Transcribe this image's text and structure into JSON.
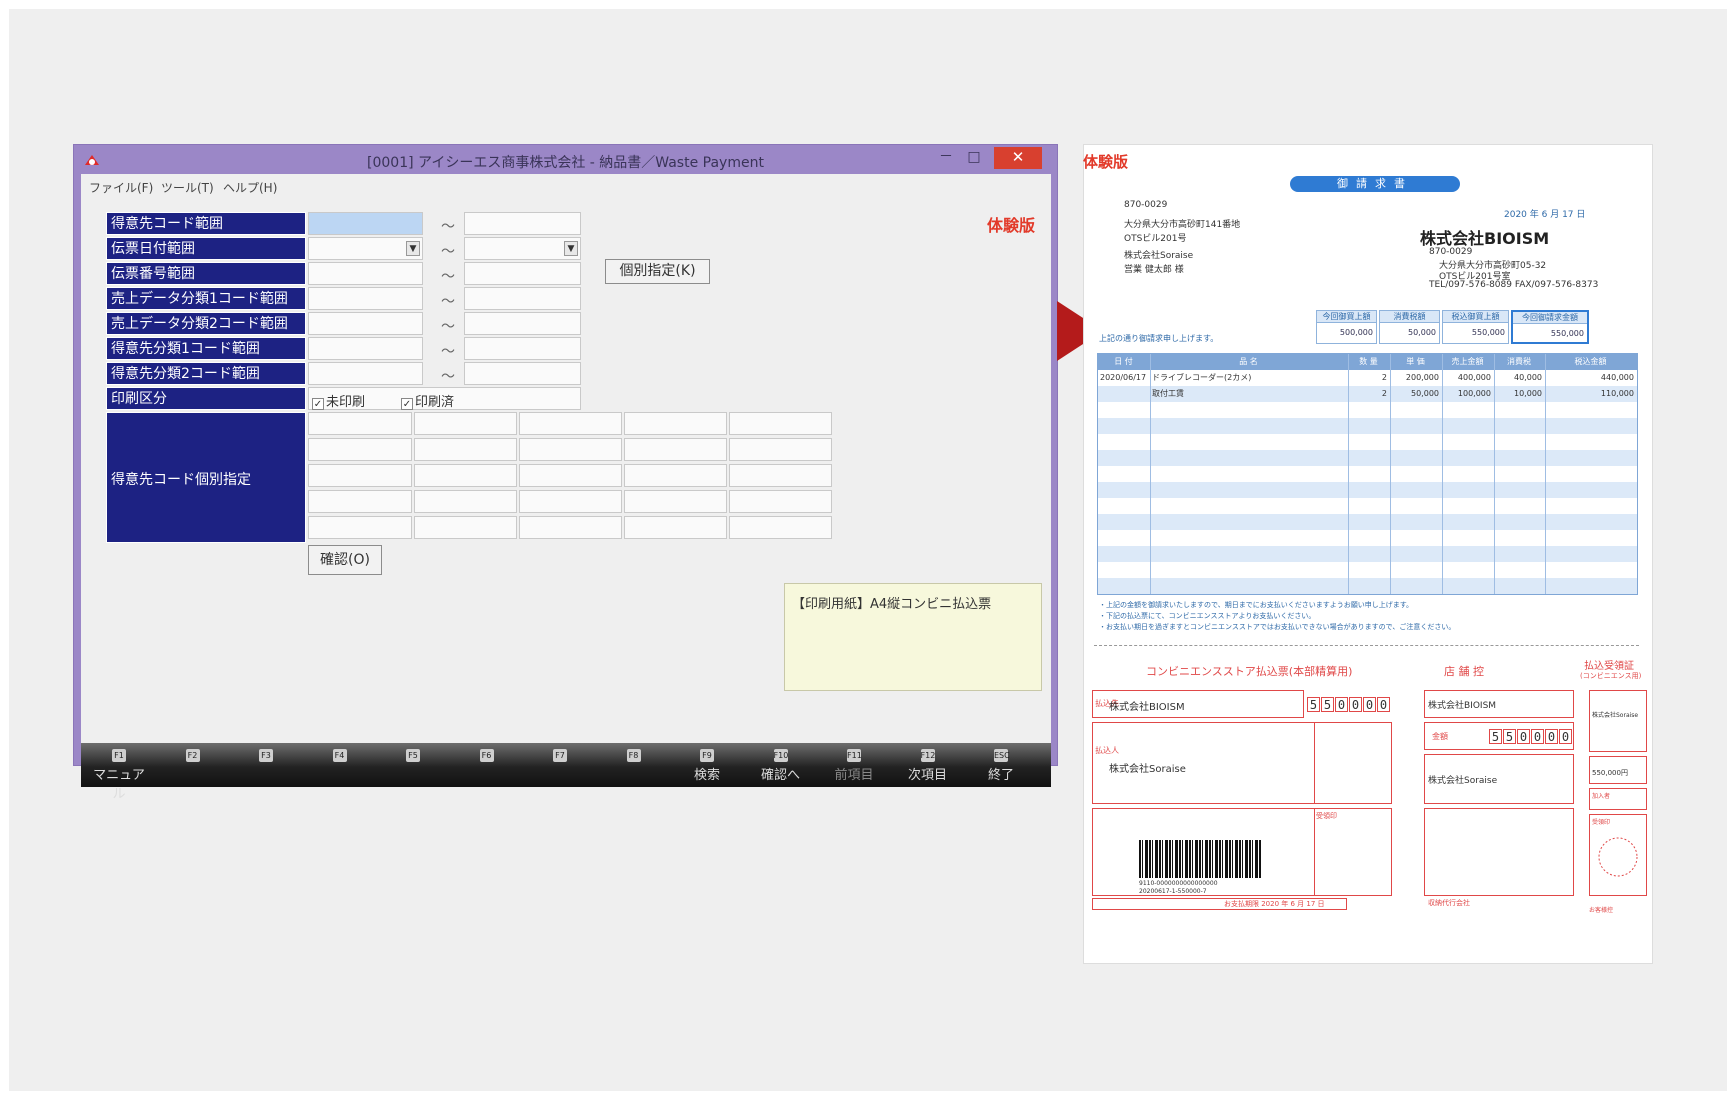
{
  "window": {
    "title": "[0001] アイシーエス商事株式会社 - 納品書／Waste Payment",
    "minimize": "－",
    "maximize": "□",
    "close": "✕"
  },
  "menu": {
    "file": "ファイル(F)",
    "tools": "ツール(T)",
    "help": "ヘルプ(H)"
  },
  "trial_label": "体験版",
  "form": {
    "labels": [
      "得意先コード範囲",
      "伝票日付範囲",
      "伝票番号範囲",
      "売上データ分類1コード範囲",
      "売上データ分類2コード範囲",
      "得意先分類1コード範囲",
      "得意先分類2コード範囲",
      "印刷区分"
    ],
    "tilde": "～",
    "individual_button": "個別指定(K)",
    "print_unprinted": "未印刷",
    "print_printed": "印刷済",
    "grid_label": "得意先コード個別指定",
    "confirm_button": "確認(O)",
    "paper_note": "【印刷用紙】A4縦コンビニ払込票"
  },
  "fkeys": [
    {
      "key": "F1",
      "label": "マニュアル"
    },
    {
      "key": "F2",
      "label": ""
    },
    {
      "key": "F3",
      "label": ""
    },
    {
      "key": "F4",
      "label": ""
    },
    {
      "key": "F5",
      "label": ""
    },
    {
      "key": "F6",
      "label": ""
    },
    {
      "key": "F7",
      "label": ""
    },
    {
      "key": "F8",
      "label": ""
    },
    {
      "key": "F9",
      "label": "検索"
    },
    {
      "key": "F10",
      "label": "確認へ"
    },
    {
      "key": "F11",
      "label": "前項目"
    },
    {
      "key": "F12",
      "label": "次項目"
    },
    {
      "key": "ESC",
      "label": "終了"
    }
  ],
  "invoice": {
    "trial_label": "体験版",
    "heading": "御請求書",
    "to_zip": "870-0029",
    "to_addr1": "大分県大分市高砂町141番地",
    "to_addr2": "OTSビル201号",
    "to_company": "株式会社Soraise",
    "to_person": "営業 健太郎 様",
    "date": "2020 年 6 月 17 日",
    "company": "株式会社BIOISM",
    "co_zip": "870-0029",
    "co_addr1": "大分県大分市高砂町05-32",
    "co_addr2": "OTSビル201号室",
    "co_tel": "TEL/097-576-8089 FAX/097-576-8373",
    "summary_headers": [
      "今回御買上額",
      "消費税額",
      "税込御買上額",
      "今回御請求金額"
    ],
    "summary_values": [
      "500,000",
      "50,000",
      "550,000",
      "550,000"
    ],
    "intro": "上記の通り御請求申し上げます。",
    "columns": [
      "日 付",
      "品 名",
      "数 量",
      "単 価",
      "売上金額",
      "消費税",
      "税込金額"
    ],
    "rows": [
      [
        "2020/06/17",
        "ドライブレコーダー(2カメ)",
        "2",
        "200,000",
        "400,000",
        "40,000",
        "440,000"
      ],
      [
        "",
        "取付工賃",
        "2",
        "50,000",
        "100,000",
        "10,000",
        "110,000"
      ]
    ],
    "notes": [
      "・上記の金額を御請求いたしますので、期日までにお支払いくださいますようお願い申し上げます。",
      "・下記の払込票にて、コンビニエンスストアよりお支払いください。",
      "・お支払い期日を過ぎますとコンビニエンスストアではお支払いできない場合がありますので、ご注意ください。"
    ],
    "slip_title": "コンビニエンスストア払込票(本部精算用)",
    "slip_store": "店 舗 控",
    "slip_receipt": "払込受領証",
    "slip_receipt_sub": "(コンビニエンス用)",
    "slip_company": "株式会社BIOISM",
    "slip_customer": "株式会社Soraise",
    "amount_digits": [
      "5",
      "5",
      "0",
      "0",
      "0",
      "0"
    ],
    "amount_label": "金額",
    "slip_amount": "550,000円",
    "barcode_text1": "9110-0000000000000000",
    "barcode_text2": "20200617-1-550000-7",
    "slip_due": "お支払期限 2020 年 6 月 17 日",
    "slip_payee": "払込先",
    "slip_payer": "払込人",
    "slip_receipt_stamp": "受領印",
    "slip_agent": "収納代行会社",
    "slip_bank": "お客様控",
    "slip_name_label": "加入者",
    "slip_person": "払込人"
  }
}
